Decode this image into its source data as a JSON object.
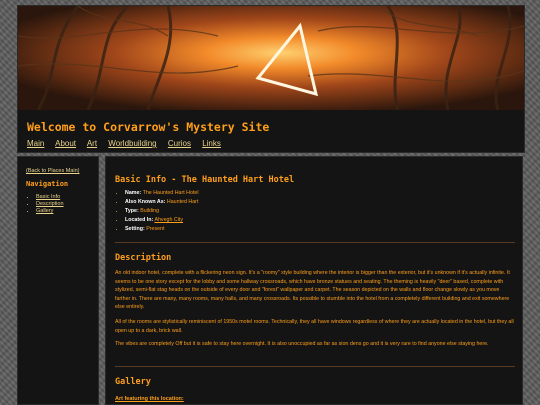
{
  "header": {
    "title": "Welcome to Corvarrow's Mystery Site",
    "nav": [
      "Main",
      "About",
      "Art",
      "Worldbuilding",
      "Curios",
      "Links"
    ]
  },
  "sidebar": {
    "back_link": "(Back to Places Main)",
    "heading": "Navigation",
    "items": [
      "Basic Info",
      "Description",
      "Gallery"
    ]
  },
  "main": {
    "basic_info_heading": "Basic Info - The Haunted Hart Hotel",
    "basic_info": [
      {
        "label": "Name:",
        "value": "The Haunted Hart Hotel"
      },
      {
        "label": "Also Known As:",
        "value": "Haunted Hart"
      },
      {
        "label": "Type:",
        "value": "Building"
      },
      {
        "label": "Located In:",
        "value": "Ahvegh City"
      },
      {
        "label": "Setting:",
        "value": "Present"
      }
    ],
    "description_heading": "Description",
    "description_paragraphs": [
      "An old indoor hotel, complete with a flickering neon sign. It's a \"roomy\" style building where the interior is bigger than the exterior, but it's unknown if it's actually infinite. It seems to be one story except for the lobby and some hallway crossroads, which have bronze statues and seating. The theming is heavily \"deer\" based, complete with stylized, semi-flat stag heads on the outside of every door and \"forest\" wallpaper and carpet. The season depicted on the walls and floor change slowly as you move farther in. There are many, many rooms, many halls, and many crossroads. Its possible to stumble into the hotel from a completely different building and exit somewhere else entirely.",
      "All of the rooms are stylistically reminiscent of 1950s motel rooms. Technically, they all have windows regardless of where they are actually located in the hotel, but they all open up to a dark, brick wall.",
      "The vibes are completely Off but it is safe to stay here overnight. It is also unoccupied as far as sion dens go and it is very rare to find anyone else staying here."
    ],
    "gallery_heading": "Gallery",
    "art_label": "Art featuring this location:"
  },
  "colors": {
    "accent": "#ff9f1a",
    "link": "#e9d48c",
    "panel": "#141414",
    "page_bg": "#5e5e5e"
  }
}
